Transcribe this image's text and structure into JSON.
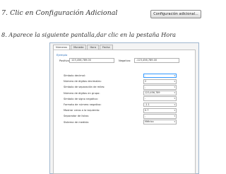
{
  "step7": {
    "text": "7. Clic en Configuración  Adicional"
  },
  "adv_button": {
    "label": "Configuración adicional..."
  },
  "step8": {
    "text": "8. Aparece la siguiente pantalla,dar clic en la pestaña Hora"
  },
  "dialog": {
    "tabs": [
      "Números",
      "Moneda",
      "Hora",
      "Fecha"
    ],
    "active_tab": "Números",
    "example": {
      "label": "Ejemplo",
      "positive_label": "Positivo:",
      "positive_value": "123,456,789.00",
      "negative_label": "Negativo:",
      "negative_value": "-123,456,789.00"
    },
    "settings": [
      {
        "label": "Símbolo decimal:",
        "value": "."
      },
      {
        "label": "Número de dígitos decimales:",
        "value": "2"
      },
      {
        "label": "Símbolo de separación de miles:",
        "value": ","
      },
      {
        "label": "Número de dígitos en grupo:",
        "value": "123,456,789"
      },
      {
        "label": "Símbolo de signo negativo:",
        "value": "-"
      },
      {
        "label": "Formato de número negativo:",
        "value": "-1.1"
      },
      {
        "label": "Mostrar ceros a la izquierda:",
        "value": "0.7"
      },
      {
        "label": "Separador de listas:",
        "value": ","
      },
      {
        "label": "Sistema de medida:",
        "value": "Métrico"
      }
    ]
  },
  "colors": {
    "accent": "#2a6ebb",
    "dialog_border": "#9fb6cf"
  }
}
